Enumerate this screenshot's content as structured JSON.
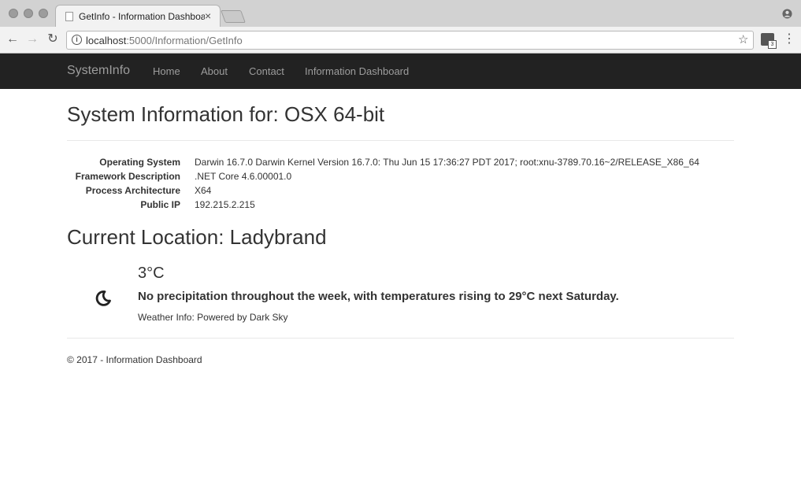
{
  "browser": {
    "tab_title": "GetInfo - Information Dashboard",
    "tab_close": "×",
    "url_host": "localhost",
    "url_path": ":5000/Information/GetInfo",
    "ext_badge": "3"
  },
  "navbar": {
    "brand": "SystemInfo",
    "links": [
      "Home",
      "About",
      "Contact",
      "Information Dashboard"
    ]
  },
  "system": {
    "title": "System Information for: OSX 64-bit",
    "rows": [
      {
        "label": "Operating System",
        "value": "Darwin 16.7.0 Darwin Kernel Version 16.7.0: Thu Jun 15 17:36:27 PDT 2017; root:xnu-3789.70.16~2/RELEASE_X86_64"
      },
      {
        "label": "Framework Description",
        "value": ".NET Core 4.6.00001.0"
      },
      {
        "label": "Process Architecture",
        "value": "X64"
      },
      {
        "label": "Public IP",
        "value": "192.215.2.215"
      }
    ]
  },
  "location": {
    "title": "Current Location: Ladybrand",
    "temperature": "3°C",
    "weather_icon": "clear-night-moon-icon",
    "summary": "No precipitation throughout the week, with temperatures rising to 29°C next Saturday.",
    "powered_by": "Weather Info: Powered by Dark Sky"
  },
  "footer": {
    "text": "© 2017 - Information Dashboard"
  }
}
